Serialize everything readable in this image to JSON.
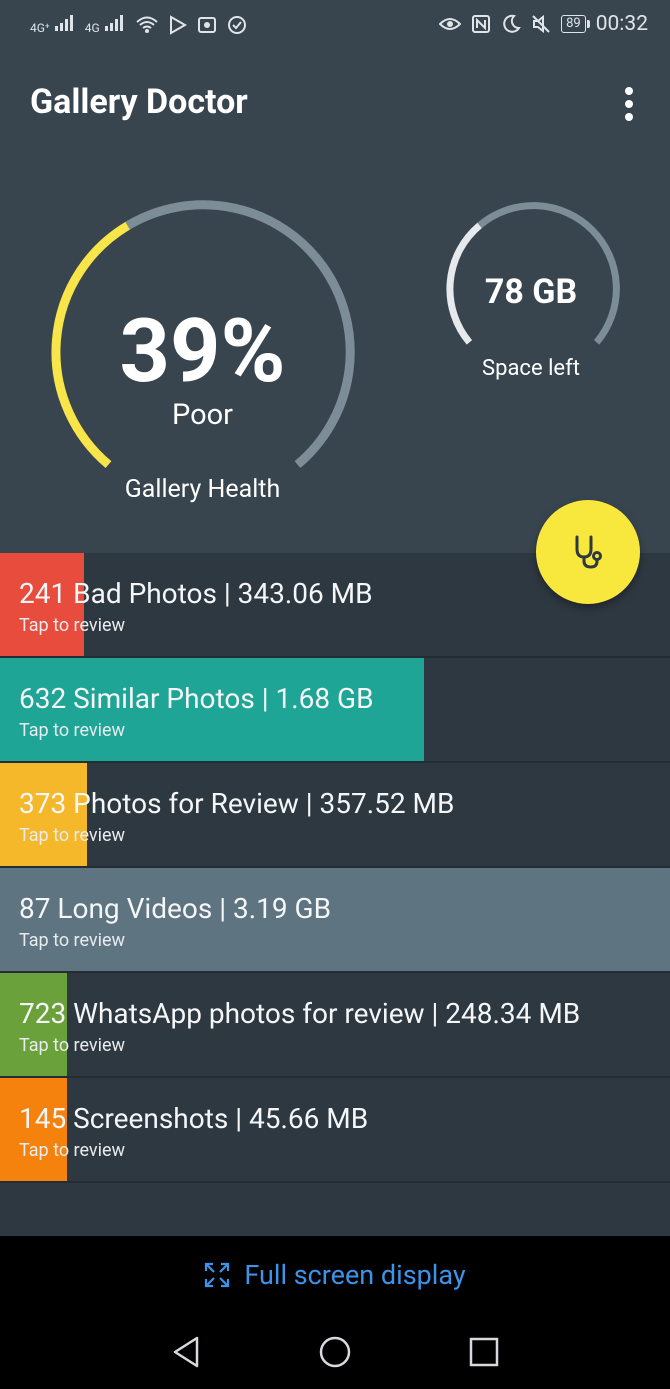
{
  "status_bar": {
    "signal_1": "4G⁺",
    "signal_2": "4G",
    "battery": "89",
    "time": "00:32"
  },
  "app": {
    "title": "Gallery Doctor",
    "menu_icon": "more-vert-icon"
  },
  "health": {
    "percent_label": "39%",
    "percent_value": 0.39,
    "status": "Poor",
    "label": "Gallery Health",
    "accent": "#f8e54a",
    "track": "#7d8d97"
  },
  "space": {
    "value": "78 GB",
    "label": "Space left",
    "accent": "#e6eaed",
    "track": "#7d8d97"
  },
  "fab": {
    "icon": "stethoscope-icon",
    "color": "#f8e73c"
  },
  "categories": [
    {
      "title": "241 Bad Photos | 343.06 MB",
      "subtitle": "Tap to review",
      "color": "#e74c3c",
      "fill": 0.125
    },
    {
      "title": "632 Similar Photos | 1.68 GB",
      "subtitle": "Tap to review",
      "color": "#1fa596",
      "fill": 0.633
    },
    {
      "title": "373 Photos for Review | 357.52 MB",
      "subtitle": "Tap to review",
      "color": "#f4b82a",
      "fill": 0.13
    },
    {
      "title": "87 Long Videos | 3.19 GB",
      "subtitle": "Tap to review",
      "color": "#5e7480",
      "fill": 1.0
    },
    {
      "title": "723 WhatsApp photos for review | 248.34 MB",
      "subtitle": "Tap to review",
      "color": "#6aa13a",
      "fill": 0.1
    },
    {
      "title": "145 Screenshots | 45.66 MB",
      "subtitle": "Tap to review",
      "color": "#f5820d",
      "fill": 0.1
    }
  ],
  "fullscreen": {
    "label": "Full screen display",
    "icon": "expand-icon",
    "color": "#3b93ea"
  },
  "nav": {
    "back": "back-triangle-icon",
    "home": "home-circle-icon",
    "recents": "recents-square-icon"
  }
}
